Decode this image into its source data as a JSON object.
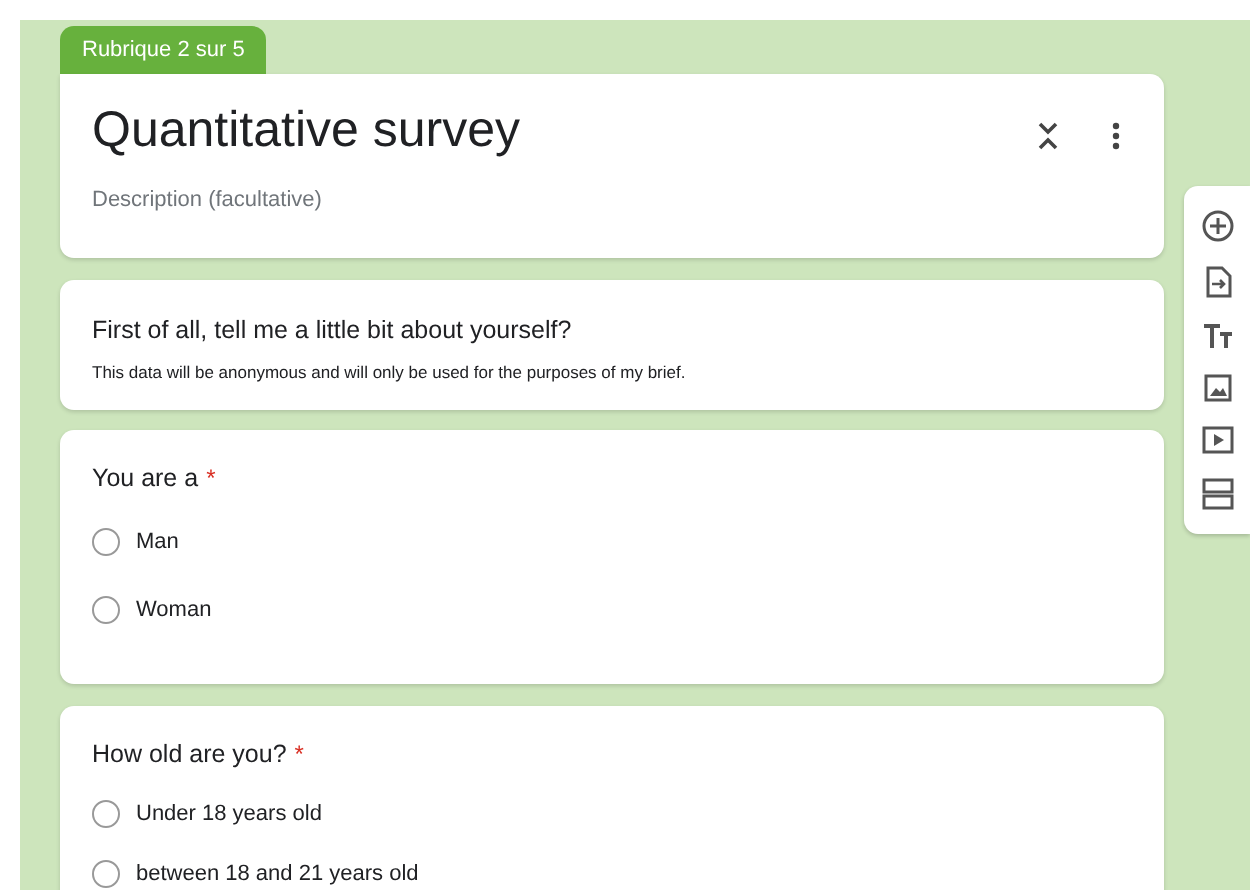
{
  "section_tab": {
    "label": "Rubrique 2 sur 5"
  },
  "header": {
    "title": "Quantitative survey",
    "description_placeholder": "Description (facultative)"
  },
  "info": {
    "title": "First of all, tell me a little bit about yourself?",
    "text": "This data will be anonymous and will only be used for the purposes of my brief."
  },
  "questions": [
    {
      "title": "You are a",
      "required": true,
      "required_mark": "*",
      "options": [
        {
          "label": "Man",
          "selected": false
        },
        {
          "label": "Woman",
          "selected": false
        }
      ]
    },
    {
      "title": "How old are you?",
      "required": true,
      "required_mark": "*",
      "options": [
        {
          "label": "Under 18 years old",
          "selected": false
        },
        {
          "label": "between 18 and 21 years old",
          "selected": false
        }
      ]
    }
  ]
}
